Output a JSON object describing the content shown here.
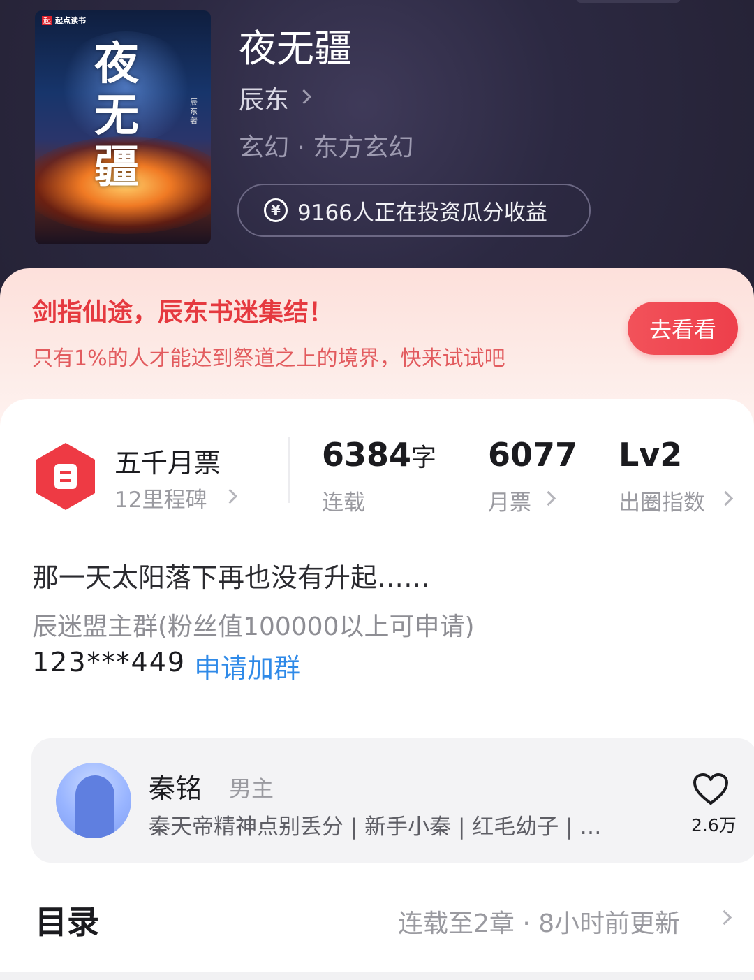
{
  "book": {
    "cover_brand": "起点读书",
    "cover_title": "夜无疆",
    "cover_author": "辰东著",
    "title": "夜无疆",
    "author": "辰东",
    "genre": "玄幻 · 东方玄幻",
    "invest_text": "9166人正在投资瓜分收益"
  },
  "promo": {
    "title": "剑指仙途，辰东书迷集结！",
    "subtitle": "只有1%的人才能达到祭道之上的境界，快来试试吧",
    "button_label": "去看看"
  },
  "stats": {
    "ticket_title": "五千月票",
    "ticket_sub": "12里程碑",
    "words_value": "6384",
    "words_unit": "字",
    "words_label": "连载",
    "monthly_value": "6077",
    "monthly_label": "月票",
    "index_value": "Lv2",
    "index_label": "出圈指数"
  },
  "intro": {
    "tagline": "那一天太阳落下再也没有升起……",
    "group_line": "辰迷盟主群(粉丝值100000以上可申请)",
    "group_number": "123***449",
    "join_label": "申请加群"
  },
  "character": {
    "name": "秦铭",
    "role": "男主",
    "tags": "秦天帝精神点别丢分 | 新手小秦 | 红毛幼子 | …",
    "likes": "2.6万"
  },
  "toc": {
    "title": "目录",
    "status": "连载至2章 · 8小时前更新"
  },
  "colors": {
    "hero_bg": "#2c2942",
    "accent_red": "#ee3f4b",
    "link_blue": "#2f8ae8"
  }
}
